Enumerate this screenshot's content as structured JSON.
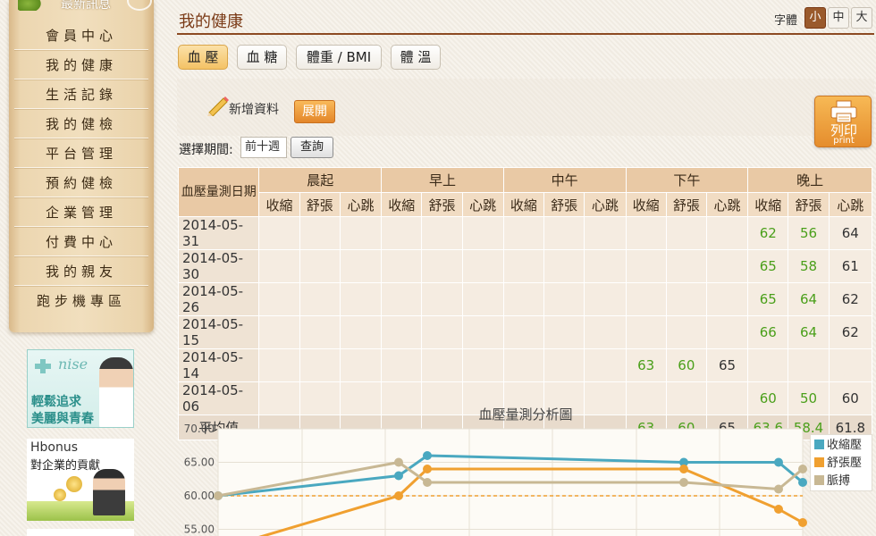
{
  "sidebar": {
    "news_label": "最新訊息",
    "items": [
      {
        "label": "會員中心"
      },
      {
        "label": "我的健康"
      },
      {
        "label": "生活記錄"
      },
      {
        "label": "我的健檢"
      },
      {
        "label": "平台管理"
      },
      {
        "label": "預約健檢"
      },
      {
        "label": "企業管理"
      },
      {
        "label": "付費中心"
      },
      {
        "label": "我的親友"
      },
      {
        "label": "跑步機專區"
      }
    ],
    "banner_nise": {
      "brand": "nise",
      "line1": "輕鬆追求",
      "line2": "美麗與青春"
    },
    "banner_hbonus": {
      "title": "Hbonus",
      "subtitle": "對企業的貢獻"
    }
  },
  "header": {
    "title": "我的健康",
    "font_size_label": "字體",
    "font_sizes": [
      "小",
      "中",
      "大"
    ],
    "font_size_selected": "小"
  },
  "tabs": [
    {
      "label": "血 壓",
      "active": true
    },
    {
      "label": "血 糖",
      "active": false
    },
    {
      "label": "體重 / BMI",
      "active": false
    },
    {
      "label": "體 溫",
      "active": false
    }
  ],
  "toolbar": {
    "new_data_label": "新增資料",
    "expand_label": "展開",
    "print_label": "列印",
    "print_en": "print"
  },
  "filter": {
    "period_label": "選擇期間:",
    "period_value": "前十週",
    "query_label": "查詢"
  },
  "table": {
    "date_header": "血壓量測日期",
    "periods": [
      "晨起",
      "早上",
      "中午",
      "下午",
      "晚上"
    ],
    "sub_headers": [
      "收縮",
      "舒張",
      "心跳"
    ],
    "rows": [
      {
        "date": "2014-05-31",
        "afternoon": [
          "",
          "",
          ""
        ],
        "evening": [
          "62",
          "56",
          "64"
        ]
      },
      {
        "date": "2014-05-30",
        "afternoon": [
          "",
          "",
          ""
        ],
        "evening": [
          "65",
          "58",
          "61"
        ]
      },
      {
        "date": "2014-05-26",
        "afternoon": [
          "",
          "",
          ""
        ],
        "evening": [
          "65",
          "64",
          "62"
        ]
      },
      {
        "date": "2014-05-15",
        "afternoon": [
          "",
          "",
          ""
        ],
        "evening": [
          "66",
          "64",
          "62"
        ]
      },
      {
        "date": "2014-05-14",
        "afternoon": [
          "63",
          "60",
          "65"
        ],
        "evening": [
          "",
          "",
          ""
        ]
      },
      {
        "date": "2014-05-06",
        "afternoon": [
          "",
          "",
          ""
        ],
        "evening": [
          "60",
          "50",
          "60"
        ]
      }
    ],
    "average": {
      "label": "平均值",
      "afternoon": [
        "63",
        "60",
        "65"
      ],
      "evening": [
        "63.6",
        "58.4",
        "61.8"
      ]
    }
  },
  "chart_data": {
    "type": "line",
    "title": "血壓量測分析圖",
    "y_ticks": [
      "70.00",
      "65.00",
      "60.00",
      "55.00"
    ],
    "ylim": [
      55,
      70
    ],
    "reference_line": 60,
    "x_points": 7,
    "series": [
      {
        "name": "收縮壓",
        "color": "#4aa8c0",
        "values": [
          60,
          63,
          66,
          null,
          65,
          65,
          62
        ]
      },
      {
        "name": "舒張壓",
        "color": "#f0a030",
        "values": [
          52,
          60,
          64,
          null,
          64,
          58,
          56
        ]
      },
      {
        "name": "脈搏",
        "color": "#c8b894",
        "values": [
          60,
          65,
          62,
          null,
          62,
          61,
          64
        ]
      }
    ],
    "legend_position": "right",
    "grid": true
  }
}
